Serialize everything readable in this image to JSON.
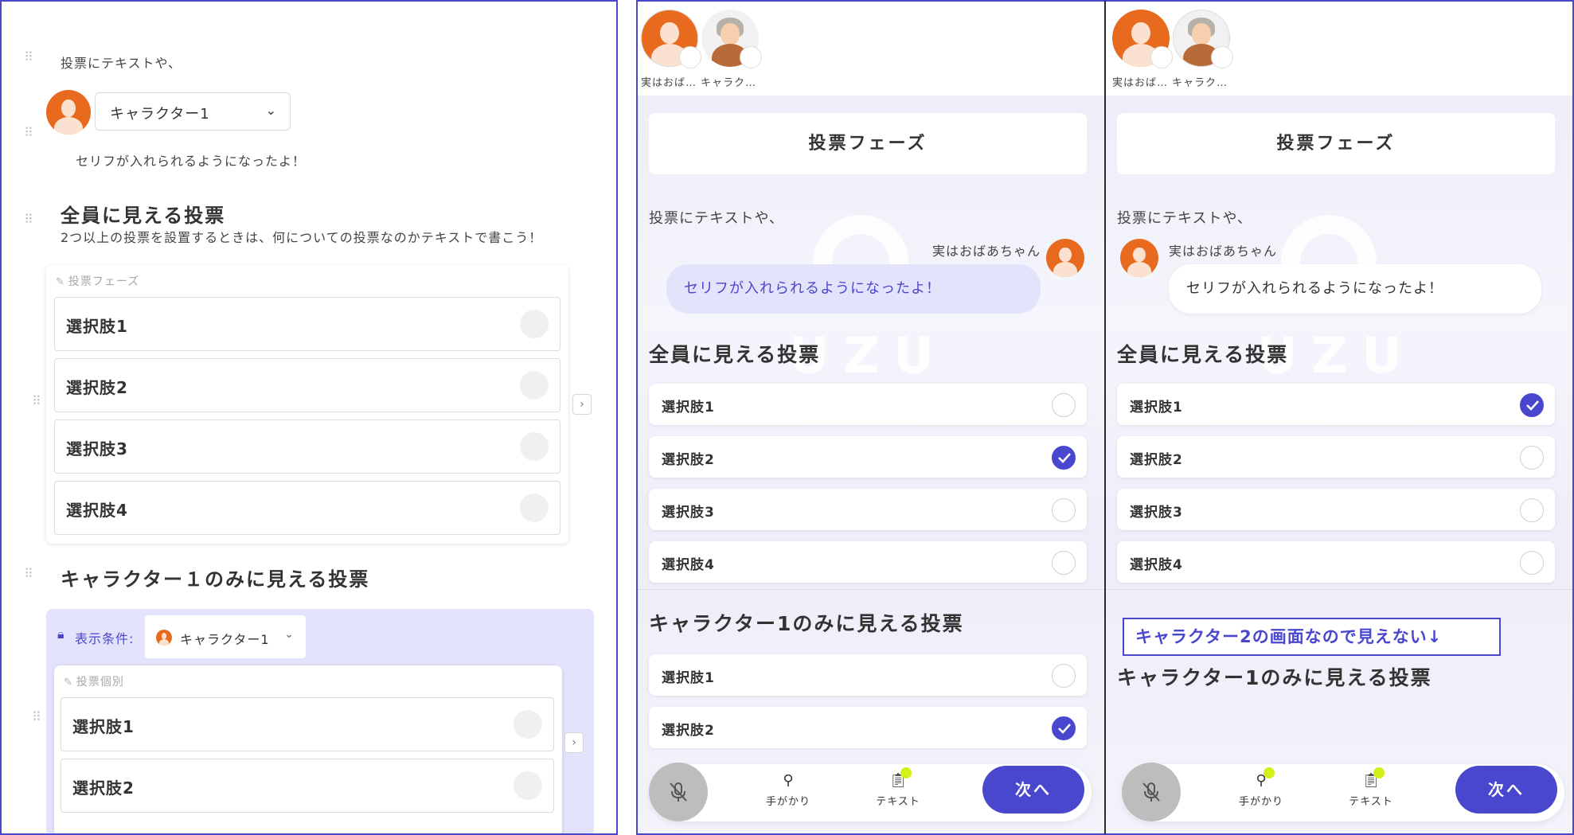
{
  "editor": {
    "intro_text": "投票にテキストや、",
    "character_select": "キャラクター1",
    "line_text": "セリフが入れられるようになったよ！",
    "public_vote": {
      "heading": "全員に見える投票",
      "subtext": "2つ以上の投票を設置するときは、何についての投票なのかテキストで書こう！",
      "card_label": "投票フェーズ",
      "options": [
        "選択肢1",
        "選択肢2",
        "選択肢3",
        "選択肢4"
      ]
    },
    "private_vote": {
      "heading": "キャラクター１のみに見える投票",
      "condition_label": "表示条件:",
      "condition_value": "キャラクター1",
      "card_label": "投票個別",
      "options": [
        "選択肢1",
        "選択肢2"
      ]
    }
  },
  "phone1": {
    "characters": [
      "実はおば…",
      "キャラク…"
    ],
    "phase_title": "投票フェーズ",
    "intro_text": "投票にテキストや、",
    "speaker_name": "実はおばあちゃん",
    "bubble_text": "セリフが入れられるようになったよ！",
    "watermark": "UZU",
    "public_heading": "全員に見える投票",
    "public_options": [
      "選択肢1",
      "選択肢2",
      "選択肢3",
      "選択肢4"
    ],
    "public_selected_index": 1,
    "private_heading": "キャラクター1のみに見える投票",
    "private_options": [
      "選択肢1",
      "選択肢2"
    ],
    "private_selected_index": 1,
    "tools": [
      "手がかり",
      "テキスト"
    ],
    "next_label": "次へ"
  },
  "phone2": {
    "characters": [
      "実はおば…",
      "キャラク…"
    ],
    "phase_title": "投票フェーズ",
    "intro_text": "投票にテキストや、",
    "speaker_name": "実はおばあちゃん",
    "bubble_text": "セリフが入れられるようになったよ！",
    "watermark": "UZU",
    "public_heading": "全員に見える投票",
    "public_options": [
      "選択肢1",
      "選択肢2",
      "選択肢3",
      "選択肢4"
    ],
    "public_selected_index": 0,
    "hidden_note": "キャラクター2の画面なので見えない↓",
    "private_heading": "キャラクター1のみに見える投票",
    "tools": [
      "手がかり",
      "テキスト"
    ],
    "next_label": "次へ"
  },
  "colors": {
    "accent": "#4a47cf",
    "avatar_orange": "#e86a1e",
    "badge": "#d3f019",
    "bubble_self": "#e3e3fc"
  },
  "icons": [
    "drag-handle-icon",
    "chevron-down-icon",
    "pen-icon",
    "chevron-right-icon",
    "lock-icon",
    "mic-off-icon",
    "search-icon",
    "clipboard-icon",
    "check-icon"
  ]
}
